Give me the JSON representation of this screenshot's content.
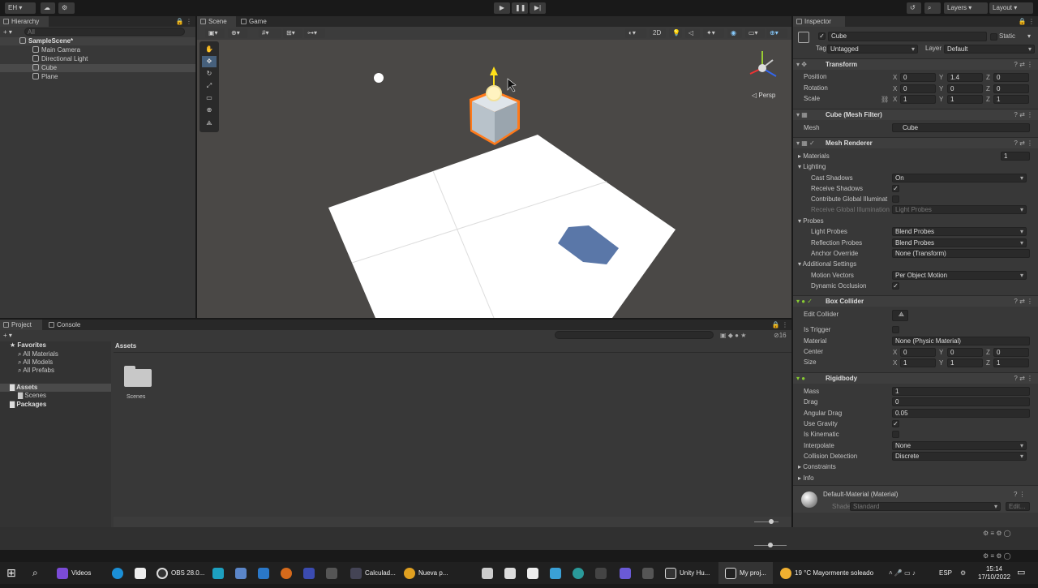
{
  "topbar": {
    "account": "EH ▾",
    "play_icon": "play-icon",
    "pause_icon": "pause-icon",
    "step_icon": "step-icon",
    "layers": "Layers",
    "layout": "Layout"
  },
  "hierarchy": {
    "tab": "Hierarchy",
    "search_placeholder": "All",
    "scene": "SampleScene*",
    "items": [
      "Main Camera",
      "Directional Light",
      "Cube",
      "Plane"
    ]
  },
  "scene_view": {
    "tab_scene": "Scene",
    "tab_game": "Game",
    "toggle_2d": "2D",
    "persp": "◁ Persp"
  },
  "project": {
    "tab_project": "Project",
    "tab_console": "Console",
    "favorites": "Favorites",
    "fav_items": [
      "All Materials",
      "All Models",
      "All Prefabs"
    ],
    "assets": "Assets",
    "assets_children": [
      "Scenes"
    ],
    "packages": "Packages",
    "breadcrumb": "Assets",
    "folder": "Scenes",
    "hidden_count": "16"
  },
  "inspector": {
    "tab": "Inspector",
    "object_name": "Cube",
    "static": "Static",
    "tag_label": "Tag",
    "tag": "Untagged",
    "layer_label": "Layer",
    "layer": "Default",
    "transform": {
      "title": "Transform",
      "position_label": "Position",
      "rotation_label": "Rotation",
      "scale_label": "Scale",
      "position": {
        "x": "0",
        "y": "1.4",
        "z": "0"
      },
      "rotation": {
        "x": "0",
        "y": "0",
        "z": "0"
      },
      "scale": {
        "x": "1",
        "y": "1",
        "z": "1"
      }
    },
    "mesh_filter": {
      "title": "Cube (Mesh Filter)",
      "mesh_label": "Mesh",
      "mesh": "Cube"
    },
    "mesh_renderer": {
      "title": "Mesh Renderer",
      "materials_label": "Materials",
      "materials_count": "1",
      "lighting": "Lighting",
      "cast_shadows_label": "Cast Shadows",
      "cast_shadows": "On",
      "receive_shadows_label": "Receive Shadows",
      "contribute_gi_label": "Contribute Global Illuminat",
      "receive_gi_label": "Receive Global Illumination",
      "receive_gi": "Light Probes",
      "probes": "Probes",
      "light_probes_label": "Light Probes",
      "light_probes": "Blend Probes",
      "reflection_probes_label": "Reflection Probes",
      "reflection_probes": "Blend Probes",
      "anchor_override_label": "Anchor Override",
      "anchor_override": "None (Transform)",
      "additional_settings": "Additional Settings",
      "motion_vectors_label": "Motion Vectors",
      "motion_vectors": "Per Object Motion",
      "dynamic_occlusion_label": "Dynamic Occlusion"
    },
    "box_collider": {
      "title": "Box Collider",
      "edit_collider_label": "Edit Collider",
      "is_trigger_label": "Is Trigger",
      "material_label": "Material",
      "material": "None (Physic Material)",
      "center_label": "Center",
      "size_label": "Size",
      "center": {
        "x": "0",
        "y": "0",
        "z": "0"
      },
      "size": {
        "x": "1",
        "y": "1",
        "z": "1"
      }
    },
    "rigidbody": {
      "title": "Rigidbody",
      "mass_label": "Mass",
      "mass": "1",
      "drag_label": "Drag",
      "drag": "0",
      "angular_drag_label": "Angular Drag",
      "angular_drag": "0.05",
      "use_gravity_label": "Use Gravity",
      "is_kinematic_label": "Is Kinematic",
      "interpolate_label": "Interpolate",
      "interpolate": "None",
      "collision_detection_label": "Collision Detection",
      "collision_detection": "Discrete",
      "constraints": "Constraints",
      "info": "Info"
    },
    "material": {
      "title": "Default-Material (Material)",
      "shader_label": "Shader",
      "shader": "Standard",
      "edit": "Edit..."
    }
  },
  "taskbar": {
    "videos": "Videos",
    "obs": "OBS 28.0...",
    "calc": "Calculad...",
    "chrome": "Nueva p...",
    "unityhub": "Unity Hu...",
    "project": "My proj...",
    "weather": "19 °C  Mayormente soleado",
    "lang": "ESP",
    "time": "15:14",
    "date": "17/10/2022"
  }
}
